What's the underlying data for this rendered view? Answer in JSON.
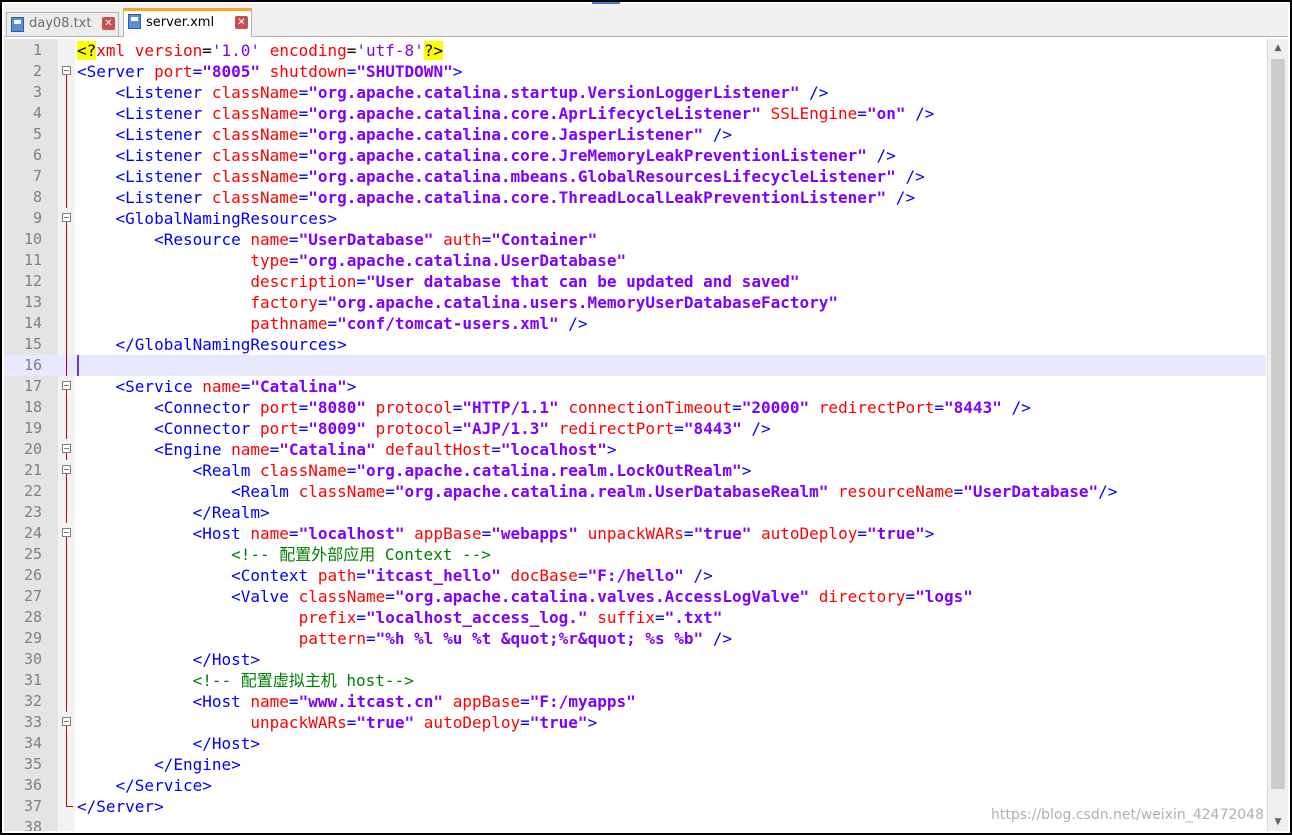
{
  "tabs": [
    {
      "label": "day08.txt",
      "active": false
    },
    {
      "label": "server.xml",
      "active": true
    }
  ],
  "watermark": "https://blog.csdn.net/weixin_42472048",
  "lines": [
    {
      "n": "1",
      "fold": "",
      "indent": 0,
      "tokens": [
        [
          "p",
          "<?"
        ],
        [
          "pa",
          "xml "
        ],
        [
          "pa",
          "version"
        ],
        [
          "",
          "="
        ],
        [
          "pv",
          "'1.0'"
        ],
        [
          "",
          " "
        ],
        [
          "pa",
          "encoding"
        ],
        [
          "",
          "="
        ],
        [
          "pv",
          "'utf-8'"
        ],
        [
          "p",
          "?>"
        ]
      ]
    },
    {
      "n": "2",
      "fold": "open",
      "indent": 0,
      "tokens": [
        [
          "b",
          "<Server "
        ],
        [
          "a",
          "port"
        ],
        [
          "b",
          "="
        ],
        [
          "v",
          "\"8005\""
        ],
        [
          "",
          " "
        ],
        [
          "a",
          "shutdown"
        ],
        [
          "b",
          "="
        ],
        [
          "v",
          "\"SHUTDOWN\""
        ],
        [
          "b",
          ">"
        ]
      ]
    },
    {
      "n": "3",
      "fold": "line",
      "indent": 1,
      "tokens": [
        [
          "b",
          "<Listener "
        ],
        [
          "a",
          "className"
        ],
        [
          "b",
          "="
        ],
        [
          "v",
          "\"org.apache.catalina.startup.VersionLoggerListener\""
        ],
        [
          "b",
          " />"
        ]
      ]
    },
    {
      "n": "4",
      "fold": "line",
      "indent": 1,
      "tokens": [
        [
          "b",
          "<Listener "
        ],
        [
          "a",
          "className"
        ],
        [
          "b",
          "="
        ],
        [
          "v",
          "\"org.apache.catalina.core.AprLifecycleListener\""
        ],
        [
          "",
          " "
        ],
        [
          "a",
          "SSLEngine"
        ],
        [
          "b",
          "="
        ],
        [
          "v",
          "\"on\""
        ],
        [
          "b",
          " />"
        ]
      ]
    },
    {
      "n": "5",
      "fold": "line",
      "indent": 1,
      "tokens": [
        [
          "b",
          "<Listener "
        ],
        [
          "a",
          "className"
        ],
        [
          "b",
          "="
        ],
        [
          "v",
          "\"org.apache.catalina.core.JasperListener\""
        ],
        [
          "b",
          " />"
        ]
      ]
    },
    {
      "n": "6",
      "fold": "line",
      "indent": 1,
      "tokens": [
        [
          "b",
          "<Listener "
        ],
        [
          "a",
          "className"
        ],
        [
          "b",
          "="
        ],
        [
          "v",
          "\"org.apache.catalina.core.JreMemoryLeakPreventionListener\""
        ],
        [
          "b",
          " />"
        ]
      ]
    },
    {
      "n": "7",
      "fold": "line",
      "indent": 1,
      "tokens": [
        [
          "b",
          "<Listener "
        ],
        [
          "a",
          "className"
        ],
        [
          "b",
          "="
        ],
        [
          "v",
          "\"org.apache.catalina.mbeans.GlobalResourcesLifecycleListener\""
        ],
        [
          "b",
          " />"
        ]
      ]
    },
    {
      "n": "8",
      "fold": "line",
      "indent": 1,
      "tokens": [
        [
          "b",
          "<Listener "
        ],
        [
          "a",
          "className"
        ],
        [
          "b",
          "="
        ],
        [
          "v",
          "\"org.apache.catalina.core.ThreadLocalLeakPreventionListener\""
        ],
        [
          "b",
          " />"
        ]
      ]
    },
    {
      "n": "9",
      "fold": "open",
      "indent": 1,
      "tokens": [
        [
          "b",
          "<GlobalNamingResources>"
        ]
      ]
    },
    {
      "n": "10",
      "fold": "line",
      "indent": 2,
      "tokens": [
        [
          "b",
          "<Resource "
        ],
        [
          "a",
          "name"
        ],
        [
          "b",
          "="
        ],
        [
          "v",
          "\"UserDatabase\""
        ],
        [
          "",
          " "
        ],
        [
          "a",
          "auth"
        ],
        [
          "b",
          "="
        ],
        [
          "v",
          "\"Container\""
        ]
      ]
    },
    {
      "n": "11",
      "fold": "line",
      "indent": 2,
      "tokens": [
        [
          "",
          "          "
        ],
        [
          "a",
          "type"
        ],
        [
          "b",
          "="
        ],
        [
          "v",
          "\"org.apache.catalina.UserDatabase\""
        ]
      ]
    },
    {
      "n": "12",
      "fold": "line",
      "indent": 2,
      "tokens": [
        [
          "",
          "          "
        ],
        [
          "a",
          "description"
        ],
        [
          "b",
          "="
        ],
        [
          "v",
          "\"User database that can be updated and saved\""
        ]
      ]
    },
    {
      "n": "13",
      "fold": "line",
      "indent": 2,
      "tokens": [
        [
          "",
          "          "
        ],
        [
          "a",
          "factory"
        ],
        [
          "b",
          "="
        ],
        [
          "v",
          "\"org.apache.catalina.users.MemoryUserDatabaseFactory\""
        ]
      ]
    },
    {
      "n": "14",
      "fold": "line",
      "indent": 2,
      "tokens": [
        [
          "",
          "          "
        ],
        [
          "a",
          "pathname"
        ],
        [
          "b",
          "="
        ],
        [
          "v",
          "\"conf/tomcat-users.xml\""
        ],
        [
          "b",
          " />"
        ]
      ]
    },
    {
      "n": "15",
      "fold": "end",
      "indent": 1,
      "tokens": [
        [
          "b",
          "</GlobalNamingResources>"
        ]
      ]
    },
    {
      "n": "16",
      "fold": "line",
      "indent": 0,
      "current": true,
      "tokens": []
    },
    {
      "n": "17",
      "fold": "open",
      "indent": 1,
      "tokens": [
        [
          "b",
          "<Service "
        ],
        [
          "a",
          "name"
        ],
        [
          "b",
          "="
        ],
        [
          "v",
          "\"Catalina\""
        ],
        [
          "b",
          ">"
        ]
      ]
    },
    {
      "n": "18",
      "fold": "line",
      "indent": 2,
      "tokens": [
        [
          "b",
          "<Connector "
        ],
        [
          "a",
          "port"
        ],
        [
          "b",
          "="
        ],
        [
          "v",
          "\"8080\""
        ],
        [
          "",
          " "
        ],
        [
          "a",
          "protocol"
        ],
        [
          "b",
          "="
        ],
        [
          "v",
          "\"HTTP/1.1\""
        ],
        [
          "",
          " "
        ],
        [
          "a",
          "connectionTimeout"
        ],
        [
          "b",
          "="
        ],
        [
          "v",
          "\"20000\""
        ],
        [
          "",
          " "
        ],
        [
          "a",
          "redirectPort"
        ],
        [
          "b",
          "="
        ],
        [
          "v",
          "\"8443\""
        ],
        [
          "b",
          " />"
        ]
      ]
    },
    {
      "n": "19",
      "fold": "line",
      "indent": 2,
      "tokens": [
        [
          "b",
          "<Connector "
        ],
        [
          "a",
          "port"
        ],
        [
          "b",
          "="
        ],
        [
          "v",
          "\"8009\""
        ],
        [
          "",
          " "
        ],
        [
          "a",
          "protocol"
        ],
        [
          "b",
          "="
        ],
        [
          "v",
          "\"AJP/1.3\""
        ],
        [
          "",
          " "
        ],
        [
          "a",
          "redirectPort"
        ],
        [
          "b",
          "="
        ],
        [
          "v",
          "\"8443\""
        ],
        [
          "b",
          " />"
        ]
      ]
    },
    {
      "n": "20",
      "fold": "open",
      "indent": 2,
      "tokens": [
        [
          "b",
          "<Engine "
        ],
        [
          "a",
          "name"
        ],
        [
          "b",
          "="
        ],
        [
          "v",
          "\"Catalina\""
        ],
        [
          "",
          " "
        ],
        [
          "a",
          "defaultHost"
        ],
        [
          "b",
          "="
        ],
        [
          "v",
          "\"localhost\""
        ],
        [
          "b",
          ">"
        ]
      ]
    },
    {
      "n": "21",
      "fold": "open",
      "indent": 3,
      "tokens": [
        [
          "b",
          "<Realm "
        ],
        [
          "a",
          "className"
        ],
        [
          "b",
          "="
        ],
        [
          "v",
          "\"org.apache.catalina.realm.LockOutRealm\""
        ],
        [
          "b",
          ">"
        ]
      ]
    },
    {
      "n": "22",
      "fold": "line",
      "indent": 4,
      "tokens": [
        [
          "b",
          "<Realm "
        ],
        [
          "a",
          "className"
        ],
        [
          "b",
          "="
        ],
        [
          "v",
          "\"org.apache.catalina.realm.UserDatabaseRealm\""
        ],
        [
          "",
          " "
        ],
        [
          "a",
          "resourceName"
        ],
        [
          "b",
          "="
        ],
        [
          "v",
          "\"UserDatabase\""
        ],
        [
          "b",
          "/>"
        ]
      ]
    },
    {
      "n": "23",
      "fold": "end",
      "indent": 3,
      "tokens": [
        [
          "b",
          "</Realm>"
        ]
      ]
    },
    {
      "n": "24",
      "fold": "open",
      "indent": 3,
      "tokens": [
        [
          "b",
          "<Host "
        ],
        [
          "a",
          "name"
        ],
        [
          "b",
          "="
        ],
        [
          "v",
          "\"localhost\""
        ],
        [
          "",
          " "
        ],
        [
          "a",
          "appBase"
        ],
        [
          "b",
          "="
        ],
        [
          "v",
          "\"webapps\""
        ],
        [
          "",
          " "
        ],
        [
          "a",
          "unpackWARs"
        ],
        [
          "b",
          "="
        ],
        [
          "v",
          "\"true\""
        ],
        [
          "",
          " "
        ],
        [
          "a",
          "autoDeploy"
        ],
        [
          "b",
          "="
        ],
        [
          "v",
          "\"true\""
        ],
        [
          "b",
          ">"
        ]
      ]
    },
    {
      "n": "25",
      "fold": "line",
      "indent": 4,
      "tokens": [
        [
          "c",
          "<!-- 配置外部应用 Context -->"
        ]
      ]
    },
    {
      "n": "26",
      "fold": "line",
      "indent": 4,
      "tokens": [
        [
          "b",
          "<Context "
        ],
        [
          "a",
          "path"
        ],
        [
          "b",
          "="
        ],
        [
          "v",
          "\"itcast_hello\""
        ],
        [
          "",
          " "
        ],
        [
          "a",
          "docBase"
        ],
        [
          "b",
          "="
        ],
        [
          "v",
          "\"F:/hello\""
        ],
        [
          "b",
          " />"
        ]
      ]
    },
    {
      "n": "27",
      "fold": "line",
      "indent": 4,
      "tokens": [
        [
          "b",
          "<Valve "
        ],
        [
          "a",
          "className"
        ],
        [
          "b",
          "="
        ],
        [
          "v",
          "\"org.apache.catalina.valves.AccessLogValve\""
        ],
        [
          "",
          " "
        ],
        [
          "a",
          "directory"
        ],
        [
          "b",
          "="
        ],
        [
          "v",
          "\"logs\""
        ]
      ]
    },
    {
      "n": "28",
      "fold": "line",
      "indent": 4,
      "tokens": [
        [
          "",
          "       "
        ],
        [
          "a",
          "prefix"
        ],
        [
          "b",
          "="
        ],
        [
          "v",
          "\"localhost_access_log.\""
        ],
        [
          "",
          " "
        ],
        [
          "a",
          "suffix"
        ],
        [
          "b",
          "="
        ],
        [
          "v",
          "\".txt\""
        ]
      ]
    },
    {
      "n": "29",
      "fold": "line",
      "indent": 4,
      "tokens": [
        [
          "",
          "       "
        ],
        [
          "a",
          "pattern"
        ],
        [
          "b",
          "="
        ],
        [
          "v",
          "\"%h %l %u %t &quot;%r&quot; %s %b\""
        ],
        [
          "b",
          " />"
        ]
      ]
    },
    {
      "n": "30",
      "fold": "end",
      "indent": 3,
      "tokens": [
        [
          "b",
          "</Host>"
        ]
      ]
    },
    {
      "n": "31",
      "fold": "line",
      "indent": 3,
      "tokens": [
        [
          "c",
          "<!-- 配置虚拟主机 host-->"
        ]
      ]
    },
    {
      "n": "32",
      "fold": "line",
      "indent": 3,
      "tokens": [
        [
          "b",
          "<Host "
        ],
        [
          "a",
          "name"
        ],
        [
          "b",
          "="
        ],
        [
          "v",
          "\"www.itcast.cn\""
        ],
        [
          "",
          " "
        ],
        [
          "a",
          "appBase"
        ],
        [
          "b",
          "="
        ],
        [
          "v",
          "\"F:/myapps\""
        ]
      ]
    },
    {
      "n": "33",
      "fold": "open",
      "indent": 3,
      "tokens": [
        [
          "",
          "      "
        ],
        [
          "a",
          "unpackWARs"
        ],
        [
          "b",
          "="
        ],
        [
          "v",
          "\"true\""
        ],
        [
          "",
          " "
        ],
        [
          "a",
          "autoDeploy"
        ],
        [
          "b",
          "="
        ],
        [
          "v",
          "\"true\""
        ],
        [
          "b",
          ">"
        ]
      ]
    },
    {
      "n": "34",
      "fold": "end",
      "indent": 3,
      "tokens": [
        [
          "b",
          "</Host>"
        ]
      ]
    },
    {
      "n": "35",
      "fold": "end",
      "indent": 2,
      "tokens": [
        [
          "b",
          "</Engine>"
        ]
      ]
    },
    {
      "n": "36",
      "fold": "end",
      "indent": 1,
      "tokens": [
        [
          "b",
          "</Service>"
        ]
      ]
    },
    {
      "n": "37",
      "fold": "close",
      "indent": 0,
      "tokens": [
        [
          "b",
          "</Server>"
        ]
      ]
    },
    {
      "n": "38",
      "fold": "",
      "indent": 0,
      "tokens": []
    }
  ]
}
